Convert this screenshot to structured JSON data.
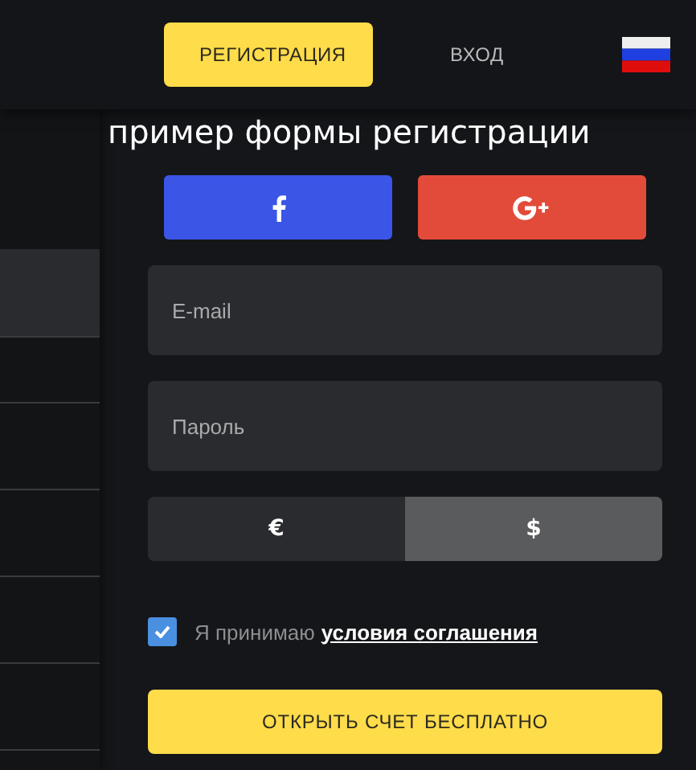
{
  "header": {
    "tabs": [
      {
        "label": "РЕГИСТРАЦИЯ",
        "selected": true
      },
      {
        "label": "ВХОД",
        "selected": false
      }
    ]
  },
  "sidebar": {
    "items": [
      {
        "selected": true
      },
      {
        "selected": false
      },
      {
        "selected": false
      },
      {
        "selected": false
      },
      {
        "selected": false
      },
      {
        "selected": false
      }
    ]
  },
  "form": {
    "title": "пример формы регистрации",
    "social": [
      {
        "kind": "facebook"
      },
      {
        "kind": "google"
      }
    ],
    "fields": [
      {
        "placeholder": "E-mail"
      },
      {
        "placeholder": "Пароль"
      }
    ],
    "currency": [
      {
        "label": "€",
        "selected": false
      },
      {
        "label": "$",
        "selected": true
      }
    ],
    "agreement": {
      "checked": true,
      "text": "Я принимаю",
      "link": "условия соглашения"
    },
    "submit": "ОТКРЫТЬ СЧЕТ БЕСПЛАТНО"
  }
}
